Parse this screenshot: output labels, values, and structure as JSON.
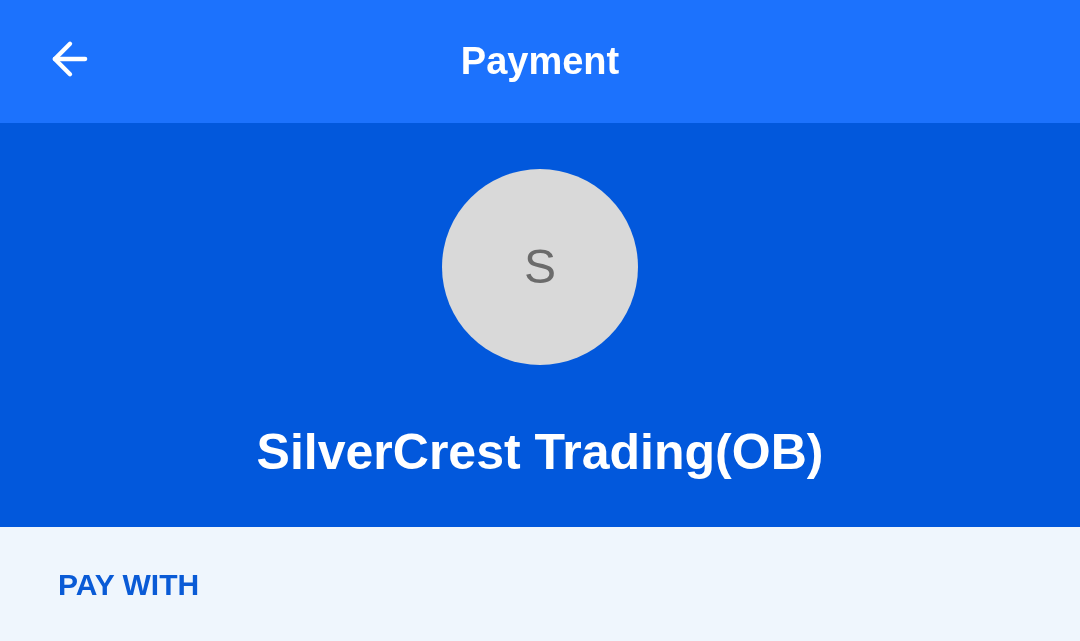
{
  "header": {
    "title": "Payment"
  },
  "payee": {
    "avatar_letter": "S",
    "name": "SilverCrest Trading(OB)"
  },
  "pay_with": {
    "label": "PAY WITH"
  }
}
